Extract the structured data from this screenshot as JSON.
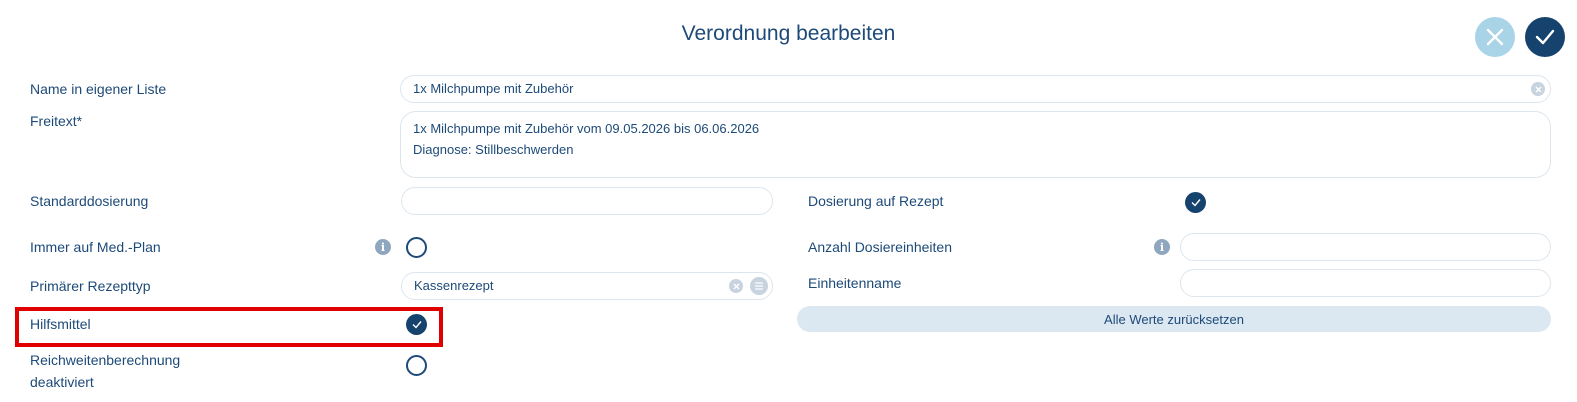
{
  "header": {
    "title": "Verordnung bearbeiten"
  },
  "form": {
    "name_label": "Name in eigener Liste",
    "name_value": "1x Milchpumpe mit Zubehör",
    "freitext_label": "Freitext*",
    "freitext_lines": [
      "1x Milchpumpe mit Zubehör vom 09.05.2026 bis 06.06.2026",
      "Diagnose: Stillbeschwerden"
    ],
    "standarddosierung_label": "Standarddosierung",
    "standarddosierung_value": "",
    "dosierung_rezept_label": "Dosierung auf Rezept",
    "dosierung_rezept_checked": true,
    "medplan_label": "Immer auf Med.-Plan",
    "medplan_checked": false,
    "anzahl_label": "Anzahl Dosiereinheiten",
    "anzahl_value": "",
    "rezepttyp_label": "Primärer Rezepttyp",
    "rezepttyp_value": "Kassenrezept",
    "einheitenname_label": "Einheitenname",
    "einheitenname_value": "",
    "hilfsmittel_label": "Hilfsmittel",
    "hilfsmittel_checked": true,
    "reset_label": "Alle Werte zurücksetzen",
    "reichweite_label_line1": "Reichweitenberechnung",
    "reichweite_label_line2": "deaktiviert",
    "reichweite_checked": false
  },
  "icons": {
    "info": "i",
    "cancel": "close-icon",
    "confirm": "check-icon"
  },
  "colors": {
    "primary": "#16436e",
    "cancel_button": "#a9d3e6",
    "highlight": "#e00000",
    "reset_button_bg": "#dbe7f1"
  }
}
